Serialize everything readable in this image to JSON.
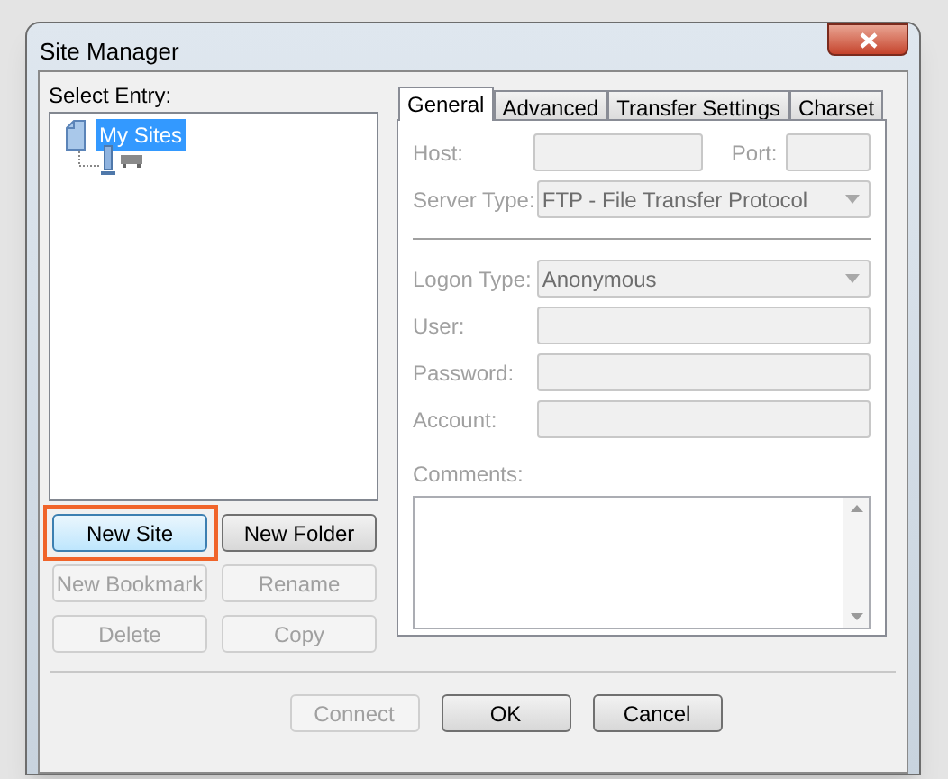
{
  "window": {
    "title": "Site Manager"
  },
  "select_entry": {
    "label": "Select Entry:",
    "tree": [
      {
        "label": "My Sites",
        "kind": "folder",
        "selected": true,
        "children": [
          {
            "kind": "site",
            "selected": false
          }
        ]
      }
    ]
  },
  "entry_buttons": [
    {
      "label": "New Site",
      "disabled": false,
      "highlighted": true,
      "focused": true
    },
    {
      "label": "New Folder",
      "disabled": false,
      "highlighted": false,
      "focused": false
    },
    {
      "label": "New Bookmark",
      "disabled": true,
      "highlighted": false
    },
    {
      "label": "Rename",
      "disabled": true,
      "highlighted": false
    },
    {
      "label": "Delete",
      "disabled": true,
      "highlighted": false
    },
    {
      "label": "Copy",
      "disabled": true,
      "highlighted": false
    }
  ],
  "tabs": [
    {
      "label": "General",
      "selected": true
    },
    {
      "label": "Advanced",
      "selected": false
    },
    {
      "label": "Transfer Settings",
      "selected": false
    },
    {
      "label": "Charset",
      "selected": false
    }
  ],
  "general": {
    "host": {
      "label": "Host:"
    },
    "port": {
      "label": "Port:"
    },
    "server_type": {
      "label": "Server Type:",
      "value": "FTP - File Transfer Protocol"
    },
    "logon_type": {
      "label": "Logon Type:",
      "value": "Anonymous"
    },
    "fields": [
      {
        "label": "User:"
      },
      {
        "label": "Password:"
      },
      {
        "label": "Account:"
      }
    ],
    "comments": {
      "label": "Comments:"
    }
  },
  "dialog_buttons": [
    {
      "label": "Connect",
      "disabled": true
    },
    {
      "label": "OK",
      "disabled": false
    },
    {
      "label": "Cancel",
      "disabled": false
    }
  ]
}
